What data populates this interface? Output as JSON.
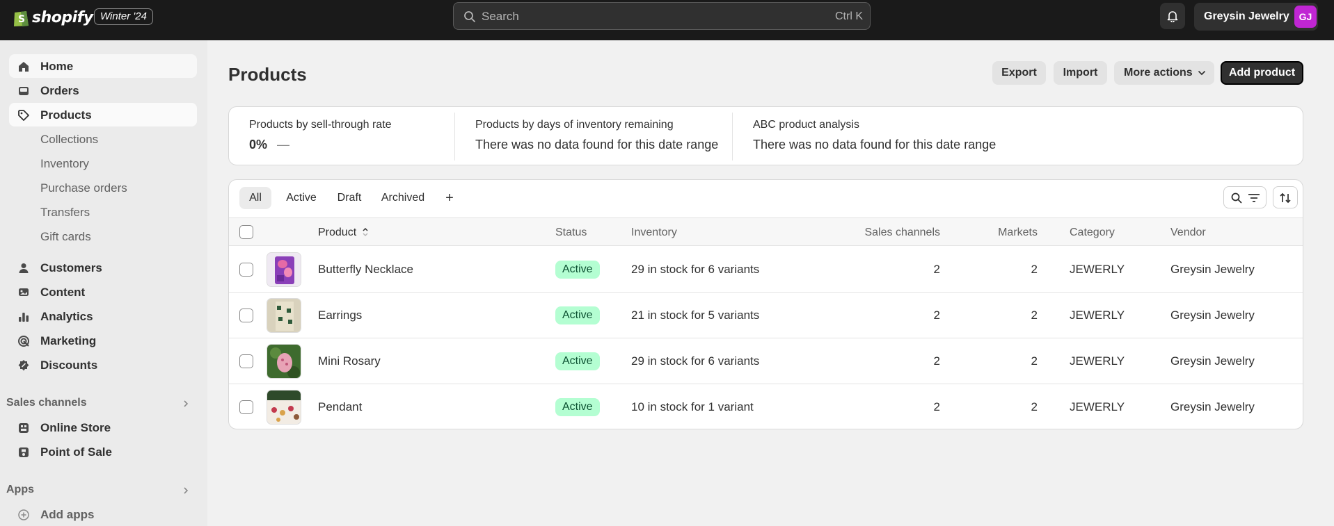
{
  "topbar": {
    "logo_text": "shopify",
    "edition_badge": "Winter '24",
    "search_placeholder": "Search",
    "search_shortcut": "Ctrl K",
    "store_name": "Greysin Jewelry",
    "avatar_initials": "GJ",
    "avatar_color": "#c026d3"
  },
  "sidebar": {
    "items": [
      {
        "label": "Home",
        "icon": "home-icon"
      },
      {
        "label": "Orders",
        "icon": "inbox-icon"
      },
      {
        "label": "Products",
        "icon": "tag-icon"
      }
    ],
    "product_subitems": [
      "Collections",
      "Inventory",
      "Purchase orders",
      "Transfers",
      "Gift cards"
    ],
    "items2": [
      {
        "label": "Customers",
        "icon": "person-icon"
      },
      {
        "label": "Content",
        "icon": "content-icon"
      },
      {
        "label": "Analytics",
        "icon": "bar-chart-icon"
      },
      {
        "label": "Marketing",
        "icon": "target-icon"
      },
      {
        "label": "Discounts",
        "icon": "discount-icon"
      }
    ],
    "sales_channels_label": "Sales channels",
    "sales_channels": [
      {
        "label": "Online Store",
        "icon": "store-icon"
      },
      {
        "label": "Point of Sale",
        "icon": "pos-icon"
      }
    ],
    "apps_label": "Apps",
    "add_apps_label": "Add apps"
  },
  "main": {
    "title": "Products",
    "actions": {
      "export": "Export",
      "import": "Import",
      "more_actions": "More actions",
      "add_product": "Add product"
    },
    "analytics": {
      "sell_through_title": "Products by sell-through rate",
      "sell_through_value": "0%",
      "sell_through_dash": "—",
      "days_inventory_title": "Products by days of inventory remaining",
      "days_inventory_value": "There was no data found for this date range",
      "abc_title": "ABC product analysis",
      "abc_value": "There was no data found for this date range"
    },
    "tabs": [
      "All",
      "Active",
      "Draft",
      "Archived",
      "+"
    ],
    "columns": {
      "product": "Product",
      "status": "Status",
      "inventory": "Inventory",
      "sales_channels": "Sales channels",
      "markets": "Markets",
      "category": "Category",
      "vendor": "Vendor"
    },
    "rows": [
      {
        "product": "Butterfly Necklace",
        "status": "Active",
        "inventory": "29 in stock for 6 variants",
        "sales_channels": "2",
        "markets": "2",
        "category": "JEWERLY",
        "vendor": "Greysin Jewelry"
      },
      {
        "product": "Earrings",
        "status": "Active",
        "inventory": "21 in stock for 5 variants",
        "sales_channels": "2",
        "markets": "2",
        "category": "JEWERLY",
        "vendor": "Greysin Jewelry"
      },
      {
        "product": "Mini Rosary",
        "status": "Active",
        "inventory": "29 in stock for 6 variants",
        "sales_channels": "2",
        "markets": "2",
        "category": "JEWERLY",
        "vendor": "Greysin Jewelry"
      },
      {
        "product": "Pendant",
        "status": "Active",
        "inventory": "10 in stock for 1 variant",
        "sales_channels": "2",
        "markets": "2",
        "category": "JEWERLY",
        "vendor": "Greysin Jewelry"
      }
    ]
  }
}
